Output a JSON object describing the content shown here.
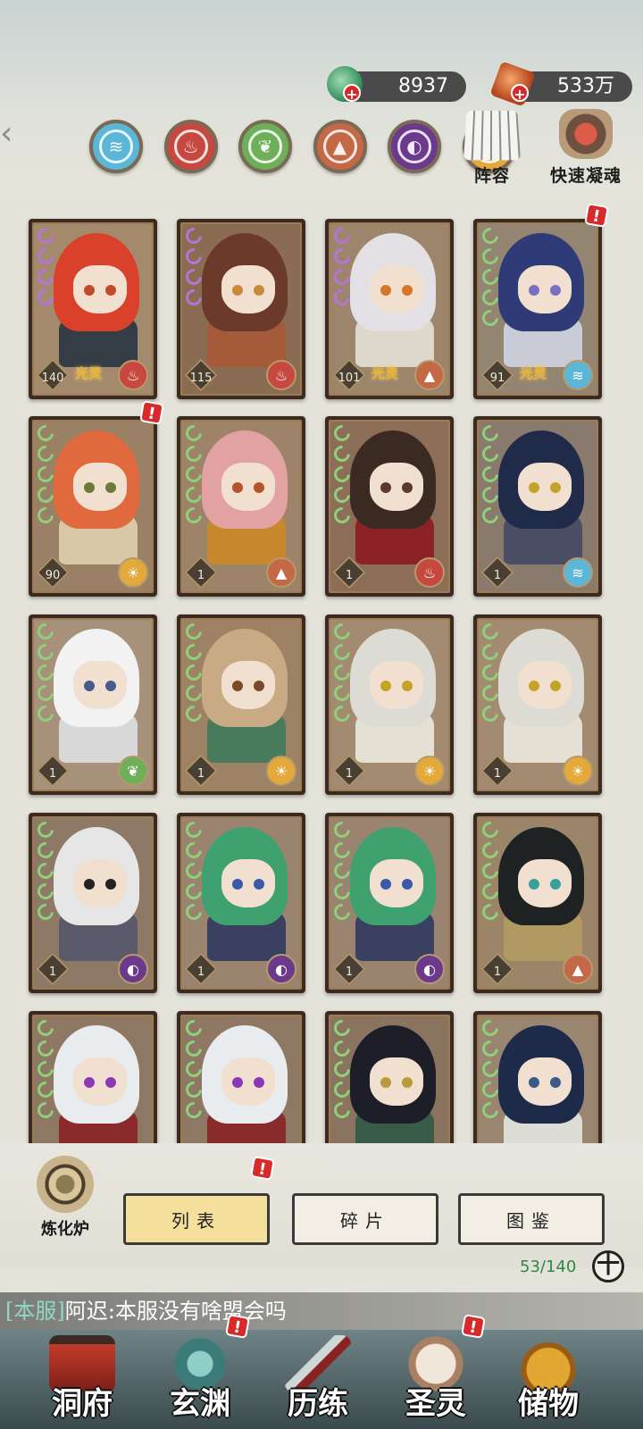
{
  "currency": {
    "jade": {
      "value": "8937",
      "icon": "jade-coin-icon"
    },
    "gold": {
      "value": "533万",
      "icon": "copper-ingot-icon"
    }
  },
  "elements": [
    {
      "name": "water",
      "color": "#5cb6d8",
      "glyph": "≋"
    },
    {
      "name": "fire",
      "color": "#c7483f",
      "glyph": "♨"
    },
    {
      "name": "wood",
      "color": "#6eaf5a",
      "glyph": "❦"
    },
    {
      "name": "earth",
      "color": "#c46848",
      "glyph": "▲"
    },
    {
      "name": "dark",
      "color": "#6c3a8c",
      "glyph": "◐"
    },
    {
      "name": "light",
      "color": "#e3a93a",
      "glyph": "☀"
    }
  ],
  "tools": {
    "lineup_label": "阵容",
    "quick_label": "快速凝魂"
  },
  "cards": [
    {
      "level": "140",
      "elem": "fire",
      "aura": "光灵",
      "pips": "purple",
      "hair": "#d9412b",
      "eyes": "#c24a2a",
      "outfit": "#343c46",
      "bg": "#a48a6c"
    },
    {
      "level": "115",
      "elem": "fire",
      "aura": "",
      "pips": "purple",
      "hair": "#6b3a2a",
      "eyes": "#c98a3a",
      "outfit": "#a55b3a",
      "bg": "#8a6c52"
    },
    {
      "level": "101",
      "elem": "earth",
      "aura": "光灵",
      "pips": "purple",
      "hair": "#e2e0e4",
      "eyes": "#d8742a",
      "outfit": "#ddd7cc",
      "bg": "#9c856b"
    },
    {
      "level": "91",
      "elem": "water",
      "aura": "光灵",
      "pips": "green",
      "hair": "#2f3b76",
      "eyes": "#7b6ec2",
      "outfit": "#c9cbd6",
      "bg": "#948472",
      "alert": true
    },
    {
      "level": "90",
      "elem": "light",
      "aura": "",
      "pips": "green",
      "hair": "#e06a3e",
      "eyes": "#6b7a3a",
      "outfit": "#d8c8a6",
      "bg": "#9a8064",
      "alert": true
    },
    {
      "level": "1",
      "elem": "earth",
      "aura": "",
      "pips": "green",
      "hair": "#e2a2a2",
      "eyes": "#b3542a",
      "outfit": "#c8892e",
      "bg": "#9d8468"
    },
    {
      "level": "1",
      "elem": "fire",
      "aura": "",
      "pips": "green",
      "hair": "#3b2a22",
      "eyes": "#5a3a2a",
      "outfit": "#8a2228",
      "bg": "#8c6e58"
    },
    {
      "level": "1",
      "elem": "water",
      "aura": "",
      "pips": "green",
      "hair": "#1f2b48",
      "eyes": "#c2a42a",
      "outfit": "#4a4f66",
      "bg": "#8a7a6e"
    },
    {
      "level": "1",
      "elem": "wood",
      "aura": "",
      "pips": "green",
      "hair": "#f2f2f2",
      "eyes": "#4a5a8a",
      "outfit": "#d8d8d8",
      "bg": "#a8917a"
    },
    {
      "level": "1",
      "elem": "light",
      "aura": "",
      "pips": "green",
      "hair": "#c8aa84",
      "eyes": "#7a4a2a",
      "outfit": "#4a7a5c",
      "bg": "#9e8266"
    },
    {
      "level": "1",
      "elem": "light",
      "aura": "",
      "pips": "green",
      "hair": "#dcdcd4",
      "eyes": "#c2a42a",
      "outfit": "#e4e0d4",
      "bg": "#a38b72"
    },
    {
      "level": "1",
      "elem": "light",
      "aura": "",
      "pips": "green",
      "hair": "#dcdcd4",
      "eyes": "#c2a42a",
      "outfit": "#e4e0d4",
      "bg": "#a38b72"
    },
    {
      "level": "1",
      "elem": "dark",
      "aura": "",
      "pips": "green",
      "hair": "#e6e6e6",
      "eyes": "#222222",
      "outfit": "#5a5a6a",
      "bg": "#8e7866"
    },
    {
      "level": "1",
      "elem": "dark",
      "aura": "",
      "pips": "green",
      "hair": "#3fa070",
      "eyes": "#3a5aa8",
      "outfit": "#3a4060",
      "bg": "#9a8470"
    },
    {
      "level": "1",
      "elem": "dark",
      "aura": "",
      "pips": "green",
      "hair": "#3fa070",
      "eyes": "#3a5aa8",
      "outfit": "#3a4060",
      "bg": "#9a8470"
    },
    {
      "level": "1",
      "elem": "earth",
      "aura": "",
      "pips": "green",
      "hair": "#1e2222",
      "eyes": "#3aa09a",
      "outfit": "#b09a62",
      "bg": "#9c8468"
    },
    {
      "level": "",
      "elem": "",
      "aura": "",
      "pips": "green",
      "hair": "#e8ecef",
      "eyes": "#8a3ab8",
      "outfit": "#8a2a2a",
      "bg": "#8e7864"
    },
    {
      "level": "",
      "elem": "",
      "aura": "",
      "pips": "green",
      "hair": "#e8ecef",
      "eyes": "#8a3ab8",
      "outfit": "#8a2a2a",
      "bg": "#8e7864"
    },
    {
      "level": "",
      "elem": "",
      "aura": "",
      "pips": "green",
      "hair": "#1e1e28",
      "eyes": "#b89a3a",
      "outfit": "#3a5a4a",
      "bg": "#8a7460"
    },
    {
      "level": "",
      "elem": "",
      "aura": "",
      "pips": "green",
      "hair": "#1e2a4a",
      "eyes": "#3a5a8a",
      "outfit": "#dcdcd4",
      "bg": "#9a8670"
    }
  ],
  "bottom": {
    "furnace_label": "炼化炉",
    "tab_list": "列表",
    "tab_shards": "碎片",
    "tab_atlas": "图鉴",
    "count": "53/140",
    "plus": "十"
  },
  "chat": {
    "channel": "[本服]",
    "message": "阿迟:本服没有啥盟会吗"
  },
  "nav": [
    {
      "label": "洞府",
      "key": "mansion",
      "alert": false
    },
    {
      "label": "玄渊",
      "key": "abyss",
      "alert": true
    },
    {
      "label": "历练",
      "key": "train",
      "alert": false
    },
    {
      "label": "圣灵",
      "key": "spirit",
      "alert": true
    },
    {
      "label": "储物",
      "key": "storage",
      "alert": false
    }
  ],
  "alert_glyph": "!"
}
